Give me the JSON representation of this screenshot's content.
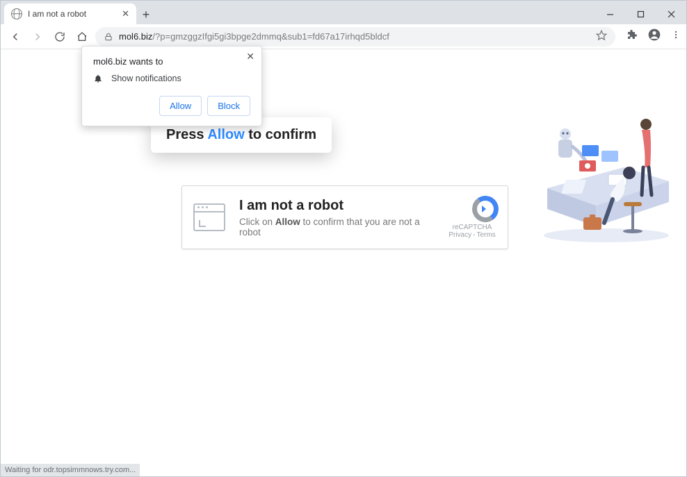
{
  "tab": {
    "title": "I am not a robot"
  },
  "url": {
    "domain": "mol6.biz",
    "path": "/?p=gmzggzIfgi5gi3bpge2dmmq&sub1=fd67a17irhqd5bldcf"
  },
  "permission": {
    "heading": "mol6.biz wants to",
    "item": "Show notifications",
    "allow": "Allow",
    "block": "Block"
  },
  "callout": {
    "pre": "Press ",
    "hi": "Allow",
    "post": " to confirm"
  },
  "captcha": {
    "title": "I am not a robot",
    "sub_pre": "Click on ",
    "sub_b": "Allow",
    "sub_post": " to confirm that you are not a robot",
    "brand": "reCAPTCHA",
    "privacy": "Privacy",
    "terms": "Terms"
  },
  "status": "Waiting for odr.topsimmnows.try.com..."
}
